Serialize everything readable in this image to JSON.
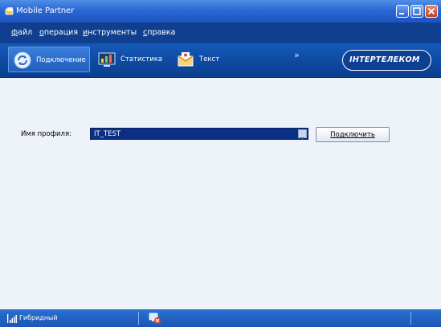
{
  "window": {
    "title": "Mobile Partner",
    "controls": [
      "minimize-icon",
      "maximize-icon",
      "close-icon"
    ],
    "accent_color": "#2b68d3"
  },
  "menu": [
    {
      "accel": "ф",
      "rest": "айл"
    },
    {
      "accel": "о",
      "rest": "перация"
    },
    {
      "accel": "и",
      "rest": "нструменты"
    },
    {
      "accel": "с",
      "rest": "правка"
    }
  ],
  "toolbar": {
    "tabs": [
      {
        "label": "Подключение",
        "icon": "connect-icon",
        "active": true
      },
      {
        "label": "Статистика",
        "icon": "statistics-icon",
        "active": false
      },
      {
        "label": "Текст",
        "icon": "sms-envelope-icon",
        "active": false
      }
    ],
    "more": "»",
    "brand": "ІНТЕРТЕЛЕКОМ"
  },
  "content": {
    "profile_label": "Имя профиля:",
    "profile_value": "IT_TEST",
    "connect_button": "Подключить"
  },
  "status": {
    "network_mode": "Гибридный",
    "signal_icon": "signal-bars-icon",
    "connection_icon": "network-disconnected-icon"
  }
}
